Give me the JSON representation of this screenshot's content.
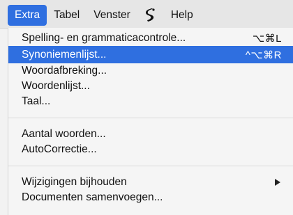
{
  "menubar": {
    "items": [
      {
        "label": "Extra"
      },
      {
        "label": "Tabel"
      },
      {
        "label": "Venster"
      },
      {
        "icon": "script-icon"
      },
      {
        "label": "Help"
      }
    ]
  },
  "menu": {
    "groups": [
      [
        {
          "label": "Spelling- en grammaticacontrole...",
          "shortcut": "⌥⌘L"
        },
        {
          "label": "Synoniemenlijst...",
          "shortcut": "^⌥⌘R"
        },
        {
          "label": "Woordafbreking..."
        },
        {
          "label": "Woordenlijst..."
        },
        {
          "label": "Taal..."
        }
      ],
      [
        {
          "label": "Aantal woorden..."
        },
        {
          "label": "AutoCorrectie..."
        }
      ],
      [
        {
          "label": "Wijzigingen bijhouden"
        },
        {
          "label": "Documenten samenvoegen..."
        }
      ]
    ]
  }
}
